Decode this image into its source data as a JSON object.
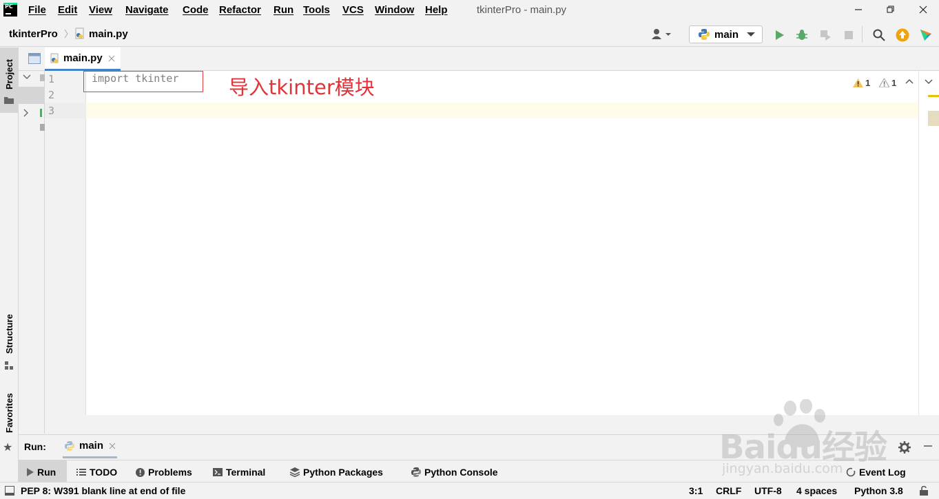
{
  "menubar": {
    "items": [
      "File",
      "Edit",
      "View",
      "Navigate",
      "Code",
      "Refactor",
      "Run",
      "Tools",
      "VCS",
      "Window",
      "Help"
    ],
    "window_title": "tkinterPro - main.py",
    "app_logo": "PC"
  },
  "navbar": {
    "project": "tkinterPro",
    "file": "main.py",
    "run_config": "main"
  },
  "left_stripe": {
    "project": "Project",
    "structure": "Structure",
    "favorites": "Favorites"
  },
  "editor": {
    "tab": "main.py",
    "line_numbers": [
      "1",
      "2",
      "3"
    ],
    "code_line_1": "import tkinter",
    "annotation": "导入tkinter模块",
    "warning_count_a": "1",
    "warning_count_b": "1"
  },
  "run_panel": {
    "label": "Run:",
    "tab": "main"
  },
  "bottom_toolbar": {
    "run": "Run",
    "todo": "TODO",
    "problems": "Problems",
    "terminal": "Terminal",
    "python_packages": "Python Packages",
    "python_console": "Python Console",
    "event_log": "Event Log"
  },
  "statusbar": {
    "message": "PEP 8: W391 blank line at end of file",
    "position": "3:1",
    "line_sep": "CRLF",
    "encoding": "UTF-8",
    "indent": "4 spaces",
    "interpreter": "Python 3.8"
  },
  "watermark": {
    "brand": "Baidu经验",
    "url": "jingyan.baidu.com"
  },
  "colors": {
    "accent": "#4083c9",
    "annotation": "#e0343a",
    "run_green": "#59a869",
    "warning": "#f2c55c"
  }
}
